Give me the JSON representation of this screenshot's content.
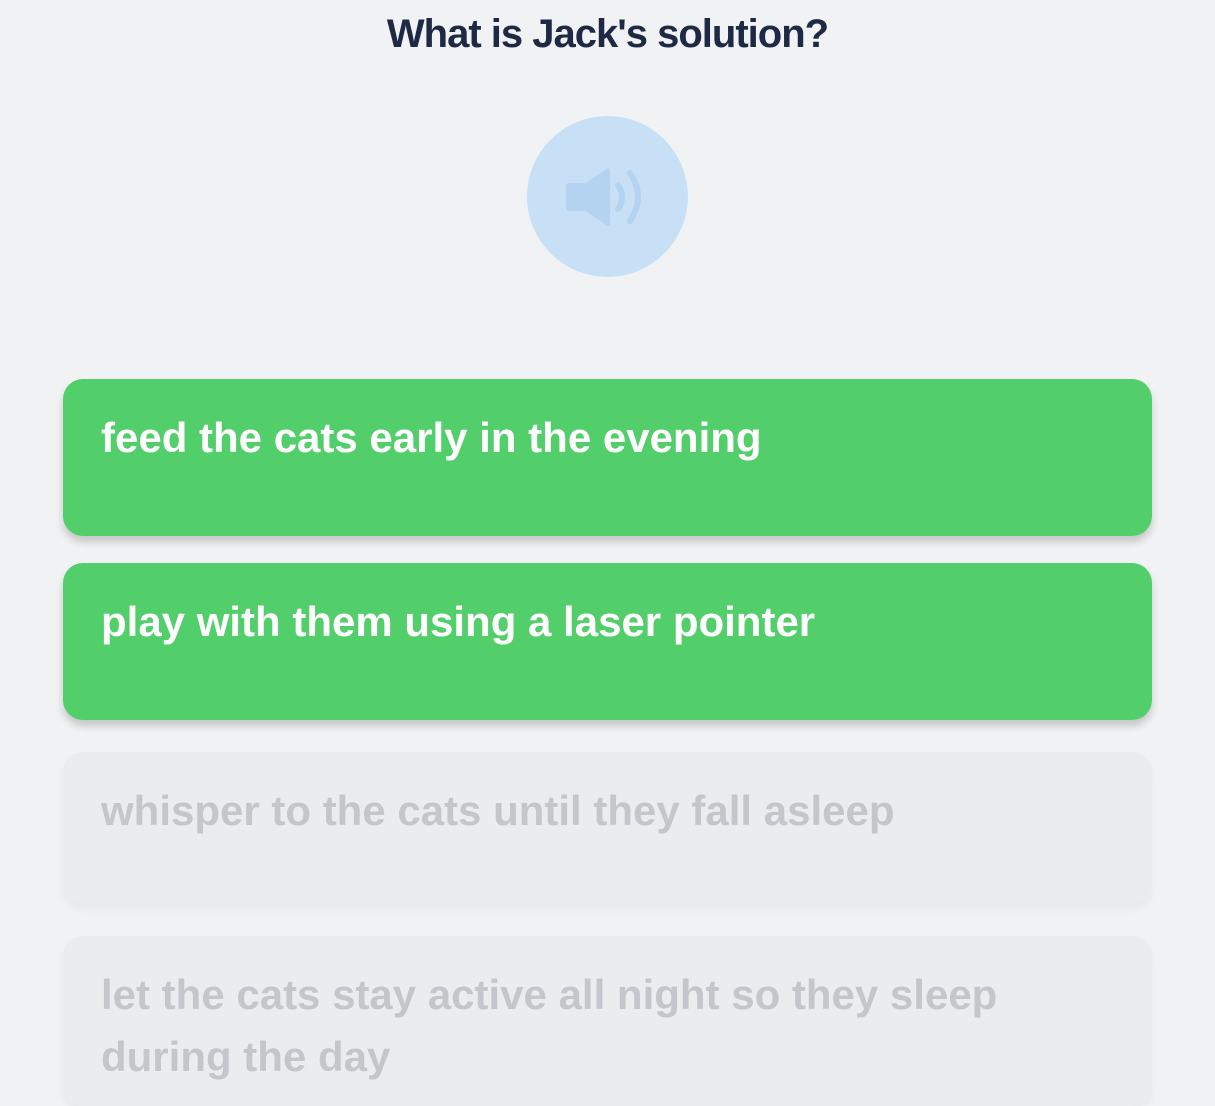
{
  "question": {
    "text": "What is Jack's solution?"
  },
  "audio": {
    "icon": "speaker-icon",
    "background_color": "#c8e0f6"
  },
  "options": [
    {
      "label": "feed the cats early in the evening",
      "state": "selected"
    },
    {
      "label": "play with them using a laser pointer",
      "state": "selected"
    },
    {
      "label": "whisper to the cats until they fall asleep",
      "state": "disabled"
    },
    {
      "label": "let the cats stay active all night so they sleep during the day",
      "state": "disabled"
    }
  ],
  "colors": {
    "selected": "#52ce6a",
    "disabled": "#ebecee",
    "question_text": "#1e2a45",
    "page_background": "#f1f2f4"
  }
}
